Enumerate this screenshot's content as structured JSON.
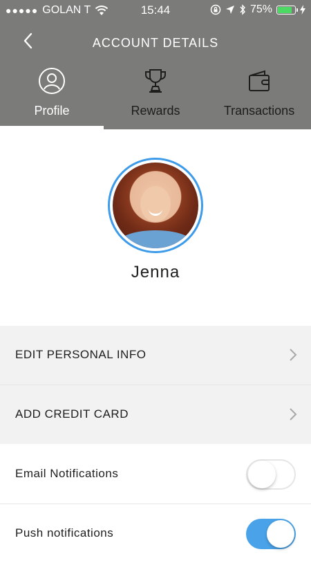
{
  "status_bar": {
    "signal": "●●●●●",
    "carrier": "GOLAN T",
    "time": "15:44",
    "battery": "75%"
  },
  "nav": {
    "title": "ACCOUNT DETAILS"
  },
  "tabs": [
    {
      "label": "Profile",
      "icon": "profile-icon",
      "active": true
    },
    {
      "label": "Rewards",
      "icon": "trophy-icon",
      "active": false
    },
    {
      "label": "Transactions",
      "icon": "wallet-icon",
      "active": false
    }
  ],
  "profile": {
    "name": "Jenna"
  },
  "menu": {
    "edit_info": "EDIT PERSONAL INFO",
    "add_card": "ADD CREDIT CARD",
    "email_notifications": "Email Notifications",
    "push_notifications": "Push notifications"
  },
  "toggles": {
    "email_notifications_on": false,
    "push_notifications_on": true
  },
  "colors": {
    "header_bg": "#7b7b79",
    "accent_blue": "#4aa3e8",
    "row_gray": "#f2f2f2",
    "battery_green": "#4cd964"
  }
}
